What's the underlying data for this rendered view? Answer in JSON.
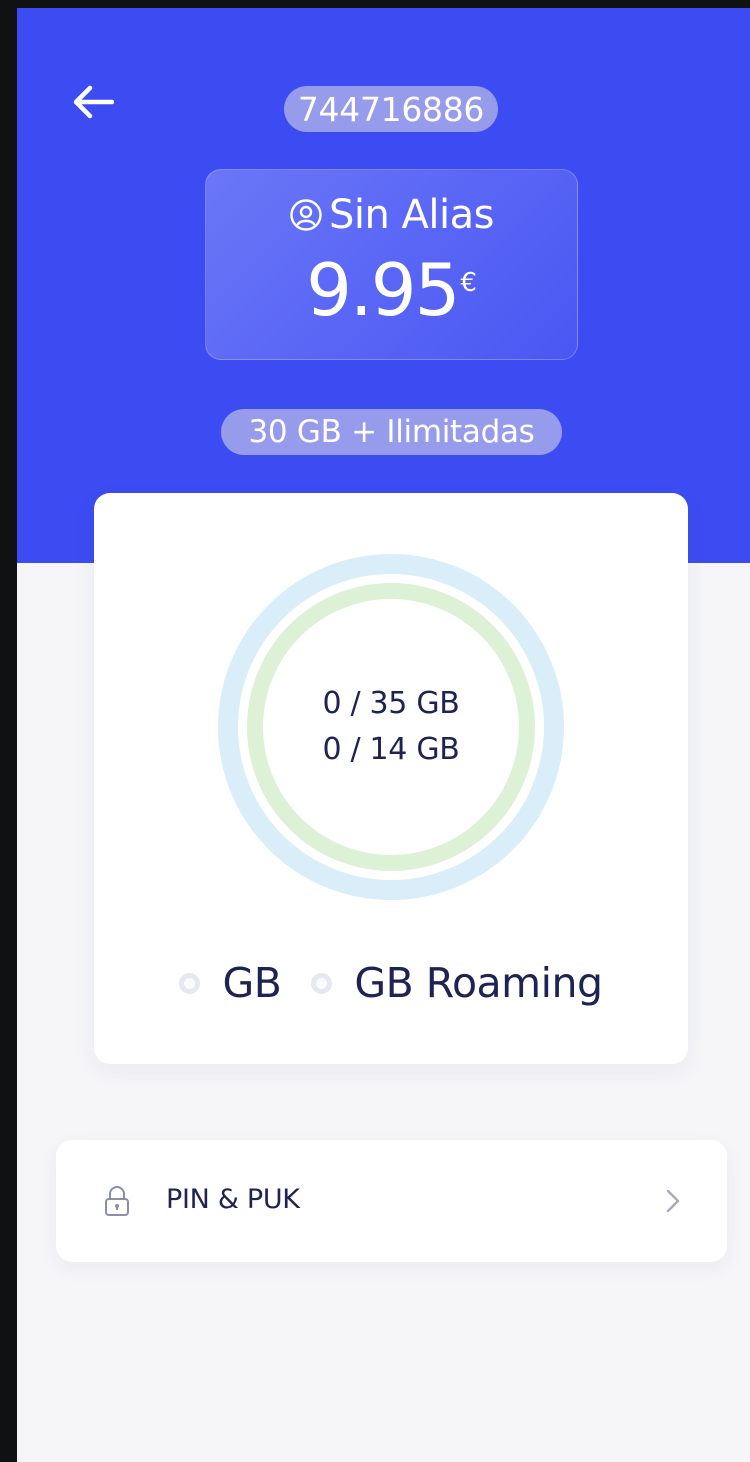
{
  "header": {
    "phone_number": "744716886",
    "alias": "Sin Alias",
    "price": "9.95",
    "currency": "€",
    "plan": "30 GB + Ilimitadas",
    "background_color": "#3d4cf2"
  },
  "usage": {
    "data_text": "0 / 35 GB",
    "roaming_text": "0 / 14 GB",
    "data_used_fraction": 0,
    "roaming_used_fraction": 0,
    "colors": {
      "data_ring": "#d9eef9",
      "roaming_ring": "#dcf1d6"
    }
  },
  "legend": {
    "items": [
      {
        "label": "GB"
      },
      {
        "label": "GB Roaming"
      }
    ]
  },
  "menu": {
    "pin_puk_label": "PIN & PUK",
    "icon": "lock-icon"
  },
  "icons": [
    "back-arrow-icon",
    "user-circle-icon",
    "lock-icon",
    "chevron-right-icon"
  ]
}
